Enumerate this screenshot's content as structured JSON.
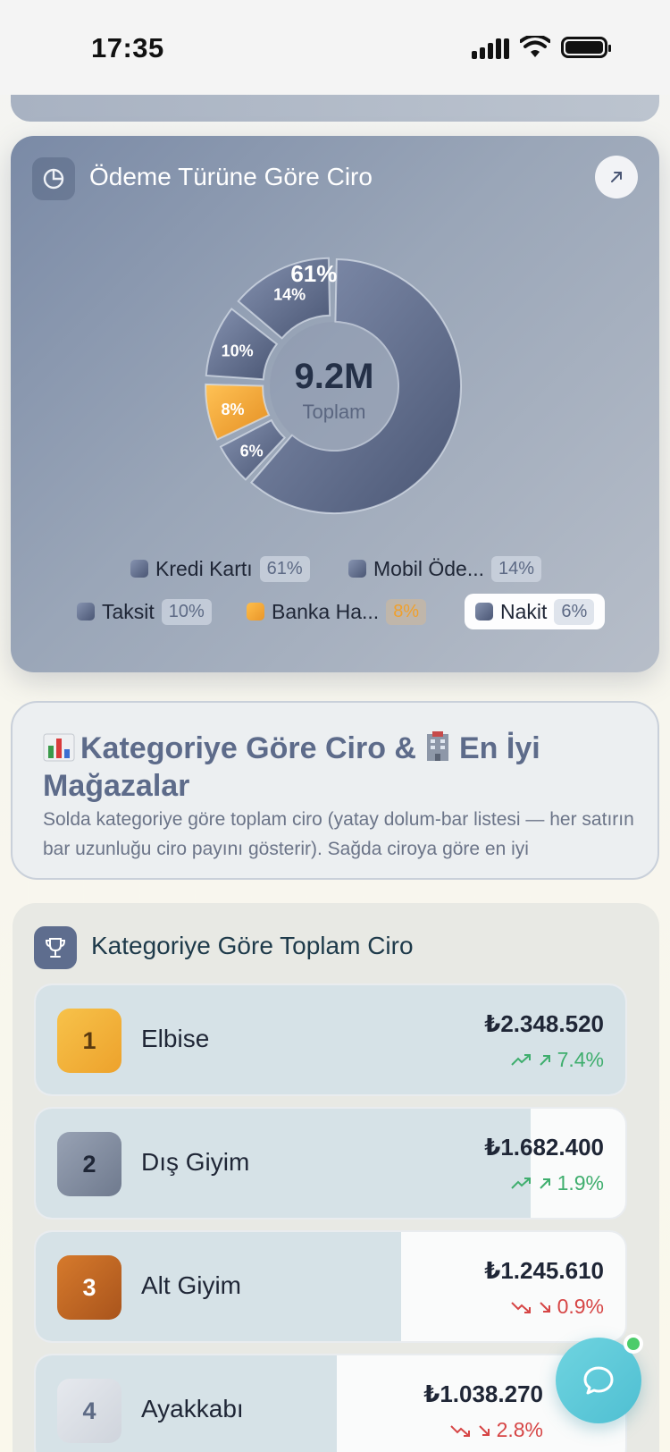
{
  "status": {
    "time": "17:35"
  },
  "payment_card": {
    "title": "Ödeme Türüne Göre Ciro",
    "center_value": "9.2M",
    "center_label": "Toplam",
    "legend": [
      {
        "label": "Kredi Kartı",
        "pct": "61%",
        "color": "#6a7794"
      },
      {
        "label": "Mobil Öde...",
        "pct": "14%",
        "color": "#5e6b88"
      },
      {
        "label": "Taksit",
        "pct": "10%",
        "color": "#5e6b88"
      },
      {
        "label": "Banka Ha...",
        "pct": "8%",
        "color": "#f0a02c"
      },
      {
        "label": "Nakit",
        "pct": "6%",
        "color": "#5e6b88"
      }
    ]
  },
  "chart_data": {
    "type": "pie",
    "categories": [
      "Kredi Kartı",
      "Nakit",
      "Banka Ha...",
      "Taksit",
      "Mobil Öde..."
    ],
    "values": [
      61,
      6,
      8,
      10,
      14
    ],
    "labels": [
      "61%",
      "6%",
      "8%",
      "10%",
      "14%"
    ],
    "center_text": "9.2M",
    "center_subtext": "Toplam",
    "highlight": "Banka Ha...",
    "colors": {
      "default": "#5e6b88",
      "highlight": "#f0a02c"
    }
  },
  "info_card": {
    "title_part1": "Kategoriye Göre Ciro &",
    "title_part2": "En İyi Mağazalar",
    "description": "Solda kategoriye göre toplam ciro (yatay dolum-bar listesi — her satırın bar uzunluğu ciro payını gösterir). Sağda ciroya göre en iyi"
  },
  "category_card": {
    "title": "Kategoriye Göre Toplam Ciro",
    "rows": [
      {
        "rank": "1",
        "name": "Elbise",
        "value": "₺2.348.520",
        "change": "7.4%",
        "trend": "up",
        "share": 1.0
      },
      {
        "rank": "2",
        "name": "Dış Giyim",
        "value": "₺1.682.400",
        "change": "1.9%",
        "trend": "up",
        "share": 0.84
      },
      {
        "rank": "3",
        "name": "Alt Giyim",
        "value": "₺1.245.610",
        "change": "0.9%",
        "trend": "down",
        "share": 0.62
      },
      {
        "rank": "4",
        "name": "Ayakkabı",
        "value": "₺1.038.270",
        "change": "2.8%",
        "trend": "down",
        "share": 0.51
      }
    ]
  }
}
